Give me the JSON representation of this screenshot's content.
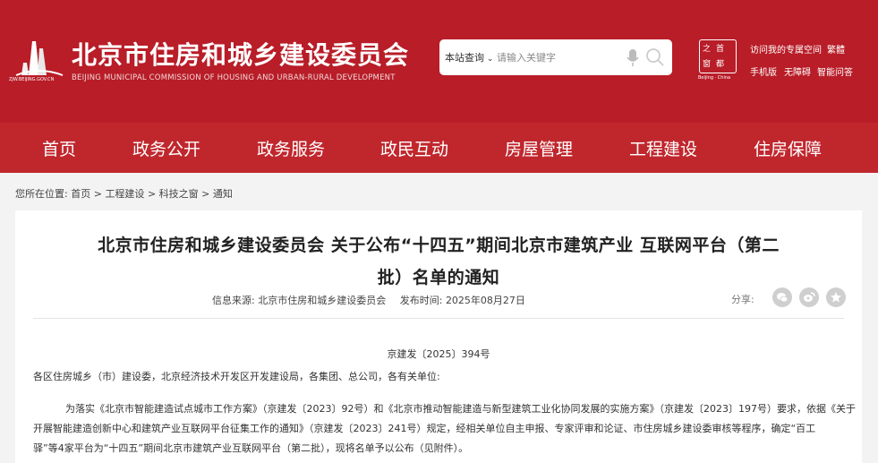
{
  "header": {
    "logo_url": "ZJW.BEIJING.GOV.CN",
    "title": "北京市住房和城乡建设委员会",
    "subtitle": "BEIJING MUNICIPAL COMMISSION OF HOUSING AND URBAN-RURAL DEVELOPMENT",
    "search": {
      "scope": "本站查询",
      "placeholder": "请输入关键字"
    },
    "capital_logo": {
      "chars": [
        "之",
        "首",
        "窗",
        "都"
      ],
      "caption": "Beijing · China"
    },
    "links_row1": [
      "访问我的专属空间",
      "繁體"
    ],
    "links_row2": [
      "手机版",
      "无障碍",
      "智能问答"
    ],
    "color": "#b81d28"
  },
  "nav": {
    "items": [
      "首页",
      "政务公开",
      "政务服务",
      "政民互动",
      "房屋管理",
      "工程建设",
      "住房保障"
    ],
    "color": "#c0272d"
  },
  "breadcrumb": {
    "prefix": "您所在位置:",
    "items": [
      "首页",
      "工程建设",
      "科技之窗",
      "通知"
    ],
    "separator": ">"
  },
  "article": {
    "title_line1": "北京市住房和城乡建设委员会 关于公布“十四五”期间北京市建筑产业 互联网平台（第二",
    "title_line2": "批）名单的通知",
    "source_label": "信息来源:",
    "source": "北京市住房和城乡建设委员会",
    "date_label": "发布时间:",
    "date": "2025年08月27日",
    "share_label": "分享:",
    "share_icons": [
      "wechat-icon",
      "weibo-icon",
      "favorite-icon"
    ],
    "doc_number": "京建发〔2025〕394号",
    "salutation": "各区住房城乡（市）建设委，北京经济技术开发区开发建设局，各集团、总公司，各有关单位:",
    "body_line1": "为落实《北京市智能建造试点城市工作方案》（京建发〔2023〕92号）和《北京市推动智能建造与新型建筑工业化协同发展的实施方案》（京建发〔2023〕197号）要求，依据《关于",
    "body_line2": "开展智能建造创新中心和建筑产业互联网平台征集工作的通知》（京建发〔2023〕241号）规定，经相关单位自主申报、专家评审和论证、市住房城乡建设委审核等程序，确定“百工",
    "body_line3": "驿”等4家平台为“十四五”期间北京市建筑产业互联网平台（第二批），现将名单予以公布（见附件）。"
  }
}
